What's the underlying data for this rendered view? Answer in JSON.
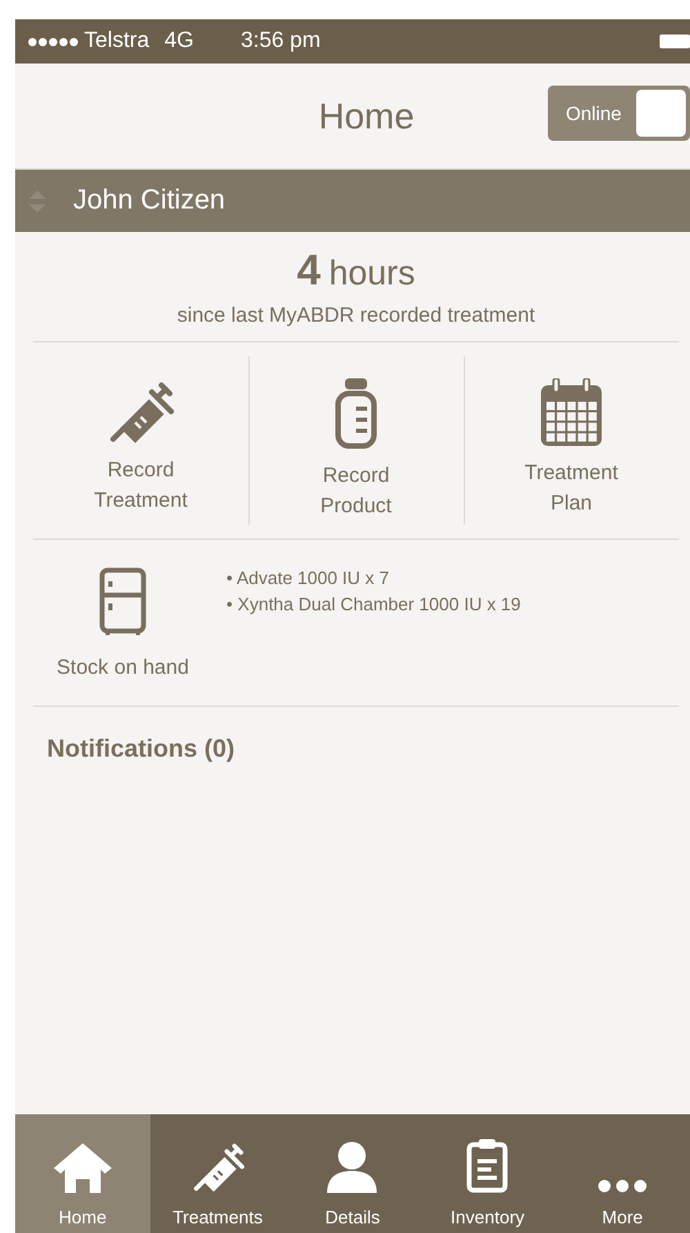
{
  "status_bar": {
    "carrier": "Telstra",
    "network": "4G",
    "time": "3:56 pm"
  },
  "header": {
    "title": "Home",
    "toggle": {
      "label": "Online",
      "on": true
    }
  },
  "patient": {
    "name": "John Citizen"
  },
  "summary": {
    "value": "4",
    "unit": "hours",
    "caption": "since last MyABDR recorded treatment"
  },
  "actions": [
    {
      "kind": "syringe",
      "label": "Record\nTreatment"
    },
    {
      "kind": "bottle",
      "label": "Record\nProduct"
    },
    {
      "kind": "calendar",
      "label": "Treatment\nPlan"
    }
  ],
  "stock": {
    "label": "Stock on hand",
    "items": [
      "• Advate 1000 IU x 7",
      "• Xyntha Dual Chamber 1000 IU x 19"
    ]
  },
  "notifications": {
    "title": "Notifications (0)"
  },
  "tabs": [
    {
      "kind": "home",
      "label": "Home",
      "selected": true
    },
    {
      "kind": "syringe",
      "label": "Treatments",
      "selected": false
    },
    {
      "kind": "person",
      "label": "Details",
      "selected": false
    },
    {
      "kind": "clipboard",
      "label": "Inventory",
      "selected": false
    },
    {
      "kind": "more",
      "label": "More",
      "selected": false
    }
  ]
}
